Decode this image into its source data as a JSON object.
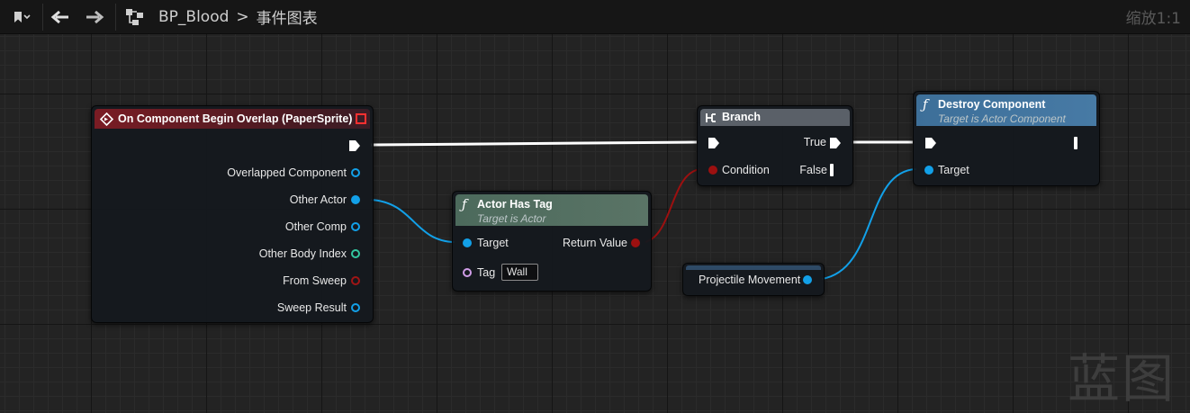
{
  "toolbar": {
    "breadcrumb_blueprint": "BP_Blood",
    "breadcrumb_separator": ">",
    "breadcrumb_graph": "事件图表",
    "zoom": "缩放1:1"
  },
  "nodes": {
    "event": {
      "title": "On Component Begin Overlap (PaperSprite)",
      "pins": {
        "overlapped_component": "Overlapped Component",
        "other_actor": "Other Actor",
        "other_comp": "Other Comp",
        "other_body_index": "Other Body Index",
        "from_sweep": "From Sweep",
        "sweep_result": "Sweep Result"
      }
    },
    "actor_has_tag": {
      "title": "Actor Has Tag",
      "subtitle": "Target is Actor",
      "pins": {
        "target": "Target",
        "tag": "Tag",
        "return_value": "Return Value"
      },
      "tag_value": "Wall"
    },
    "branch": {
      "title": "Branch",
      "pins": {
        "condition": "Condition",
        "true": "True",
        "false": "False"
      }
    },
    "destroy_component": {
      "title": "Destroy Component",
      "subtitle": "Target is Actor Component",
      "pins": {
        "target": "Target"
      }
    },
    "projectile_movement": {
      "title": "Projectile Movement"
    }
  },
  "colors": {
    "object_pin": "#12a0e8",
    "bool_pin": "#9c1010",
    "int_pin": "#33c7a0",
    "name_pin": "#d09de8",
    "event_header": "#7a1c24",
    "pure_function_header": "#4c6a5c",
    "function_header": "#3d6f99",
    "branch_header": "#5a6068"
  },
  "watermark": "蓝图"
}
